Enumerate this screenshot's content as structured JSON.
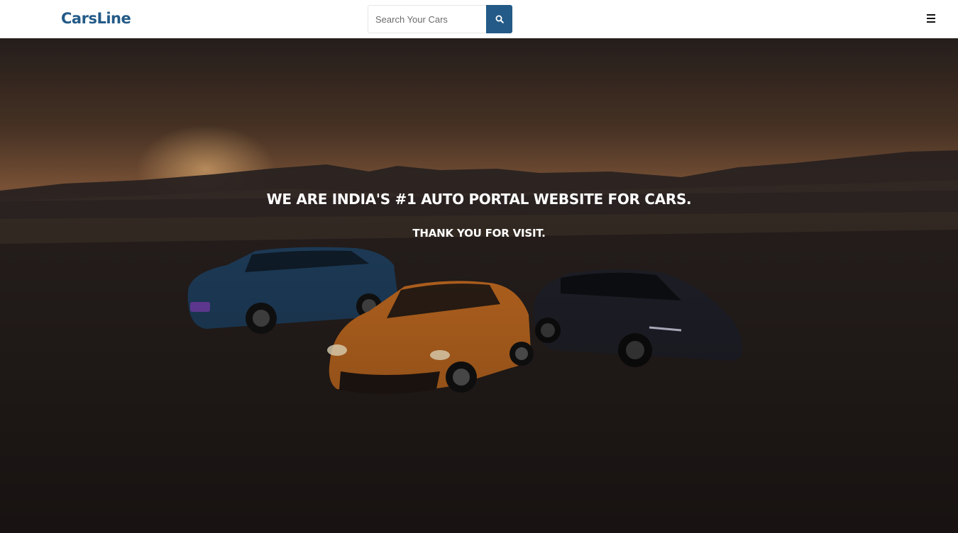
{
  "brand": {
    "logo_text": "CarsLine",
    "color": "#235a87"
  },
  "search": {
    "placeholder": "Search Your Cars",
    "button_icon": "search-icon",
    "button_color": "#235a87"
  },
  "nav": {
    "menu_icon": "hamburger-menu-icon"
  },
  "hero": {
    "headline": "WE ARE INDIA'S #1 AUTO PORTAL WEBSITE FOR CARS.",
    "subline": "THANK YOU FOR VISIT.",
    "background": "sunset desert road with three cars"
  }
}
